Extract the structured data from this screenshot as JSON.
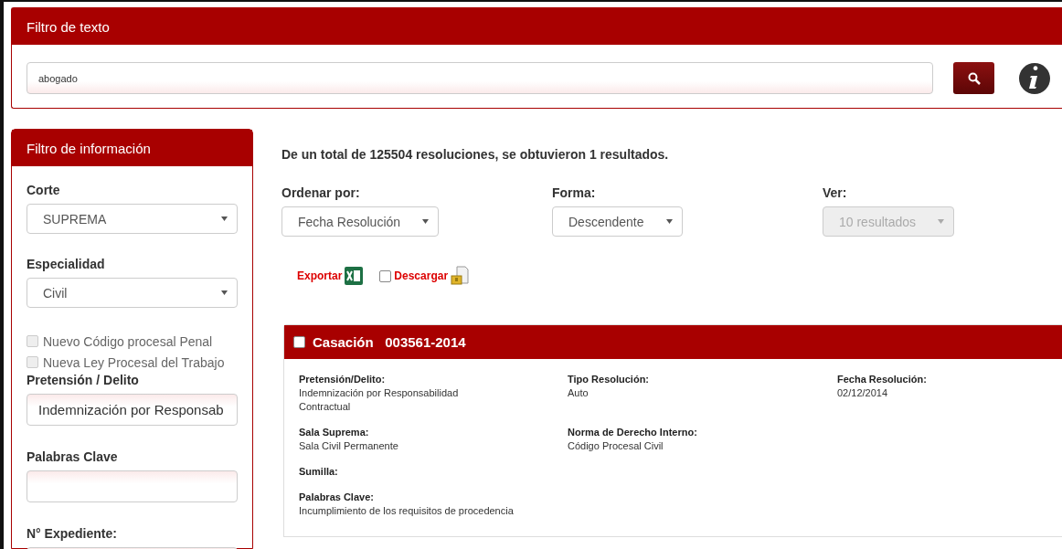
{
  "text_filter": {
    "title": "Filtro de texto",
    "query": "abogado"
  },
  "info_filter": {
    "title": "Filtro de información",
    "fields": [
      {
        "kind": "select",
        "label": "Corte",
        "value": "SUPREMA"
      },
      {
        "kind": "select",
        "label": "Especialidad",
        "value": "Civil"
      },
      {
        "kind": "checkbox",
        "label": "Nuevo Código procesal Penal",
        "checked": false,
        "disabled": true
      },
      {
        "kind": "checkbox",
        "label": "Nueva Ley Procesal del Trabajo",
        "checked": false,
        "disabled": true
      },
      {
        "kind": "input",
        "label": "Pretensión / Delito",
        "value": "Indemnización por Responsab"
      },
      {
        "kind": "input",
        "label": "Palabras Clave"
      },
      {
        "kind": "input",
        "label": "N° Expediente:"
      }
    ]
  },
  "results": {
    "summary": "De un total de 125504 resoluciones, se obtuvieron 1 resultados.",
    "controls": [
      {
        "label": "Ordenar por:",
        "value": "Fecha Resolución",
        "disabled": false
      },
      {
        "label": "Forma:",
        "value": "Descendente",
        "disabled": false
      },
      {
        "label": "Ver:",
        "value": "10 resultados",
        "disabled": true
      }
    ],
    "export": {
      "label": "Exportar"
    },
    "download": {
      "label": "Descargar",
      "checked": false
    },
    "cards": [
      {
        "type": "Casación",
        "number": "003561-2014",
        "checked": false,
        "rows": [
          [
            {
              "label": "Pretensión/Delito:",
              "value": "Indemnización por Responsabilidad Contractual"
            },
            {
              "label": "Tipo Resolución:",
              "value": "Auto"
            },
            {
              "label": "Fecha Resolución:",
              "value": "02/12/2014"
            }
          ],
          [
            {
              "label": "Sala Suprema:",
              "value": "Sala Civil Permanente"
            },
            {
              "label": "Norma de Derecho Interno:",
              "value": "Código Procesal Civil"
            }
          ],
          [
            {
              "label": "Sumilla:"
            }
          ],
          [
            {
              "label": "Palabras Clave:",
              "value": "Incumplimiento de los requisitos de procedencia"
            }
          ]
        ]
      }
    ]
  }
}
